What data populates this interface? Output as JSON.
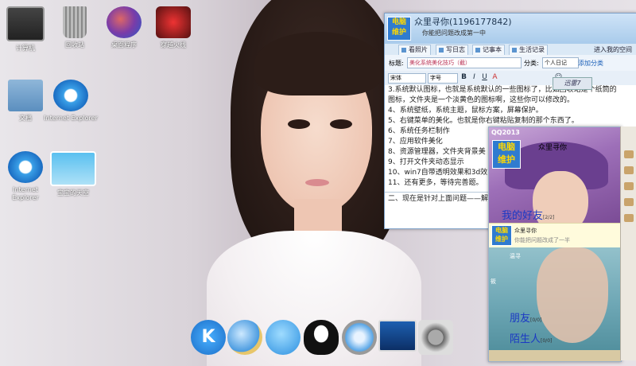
{
  "desktop": {
    "icons": [
      {
        "label": "计算机"
      },
      {
        "label": "回收站"
      },
      {
        "label": "桌面程序"
      },
      {
        "label": "穿越火线"
      },
      {
        "label": "文档"
      },
      {
        "label": "Internet Explorer"
      },
      {
        "label": "Internet Explorer"
      },
      {
        "label": "宝宝的天空"
      }
    ]
  },
  "dock": {
    "items": [
      "k-icon",
      "search-icon",
      "bubble-icon",
      "qq-penguin-icon",
      "safari-compass-icon",
      "monitor-icon",
      "settings-gear-icon"
    ]
  },
  "qq_window": {
    "name": "众里寻你(1196177842)",
    "signature": "你能把问题改成第一中",
    "tabs": [
      "看照片",
      "写日志",
      "记事本",
      "生活记录"
    ],
    "enter_space": "进入我的空间",
    "title_label": "标题:",
    "title_value": "美化系统美化技巧（截）",
    "category_label": "分类:",
    "category_value": "个人日记",
    "add_category": "添加分类",
    "font_name": "宋体",
    "font_size": "字号",
    "xunlei": "迅雷7",
    "lines": [
      "3.系统默认图标，也就是系统默认的一些图标了，比如回收站是个纸筒的",
      "图标，文件夹是一个淡黄色的图标啊，这些你可以修改的。",
      "4、系统壁纸，系统主题，鼠标方案，屏幕保护。",
      "5、右键菜单的美化。也就是你右键粘贴复制的那个东西了。",
      "6、系统任务栏制作",
      "7、应用软件美化",
      "8、资源管理器，文件夹背景美",
      "9、打开文件夹动态显示",
      "10、win7自带透明效果和3d效",
      "11、还有更多，等待完善题。"
    ],
    "footer_line": "二、现在是针对上面问题——解"
  },
  "qq_panel": {
    "title": "QQ2013",
    "logo": "电脑维护",
    "name": "众里寻你",
    "banner": "我的好友",
    "banner_count": "[2/2]",
    "notif_name": "众里寻你",
    "notif_msg": "你能把问题改成了一半",
    "row1": "温寻",
    "row2": "筱",
    "group_friends": "朋友",
    "group_friends_count": "[0/0]",
    "group_strangers": "陌生人",
    "group_strangers_count": "[0/0]"
  },
  "colors": {
    "qq_blue": "#2f7bd0",
    "link_blue": "#1b39c4",
    "title_bar": "#a9cbeb"
  }
}
